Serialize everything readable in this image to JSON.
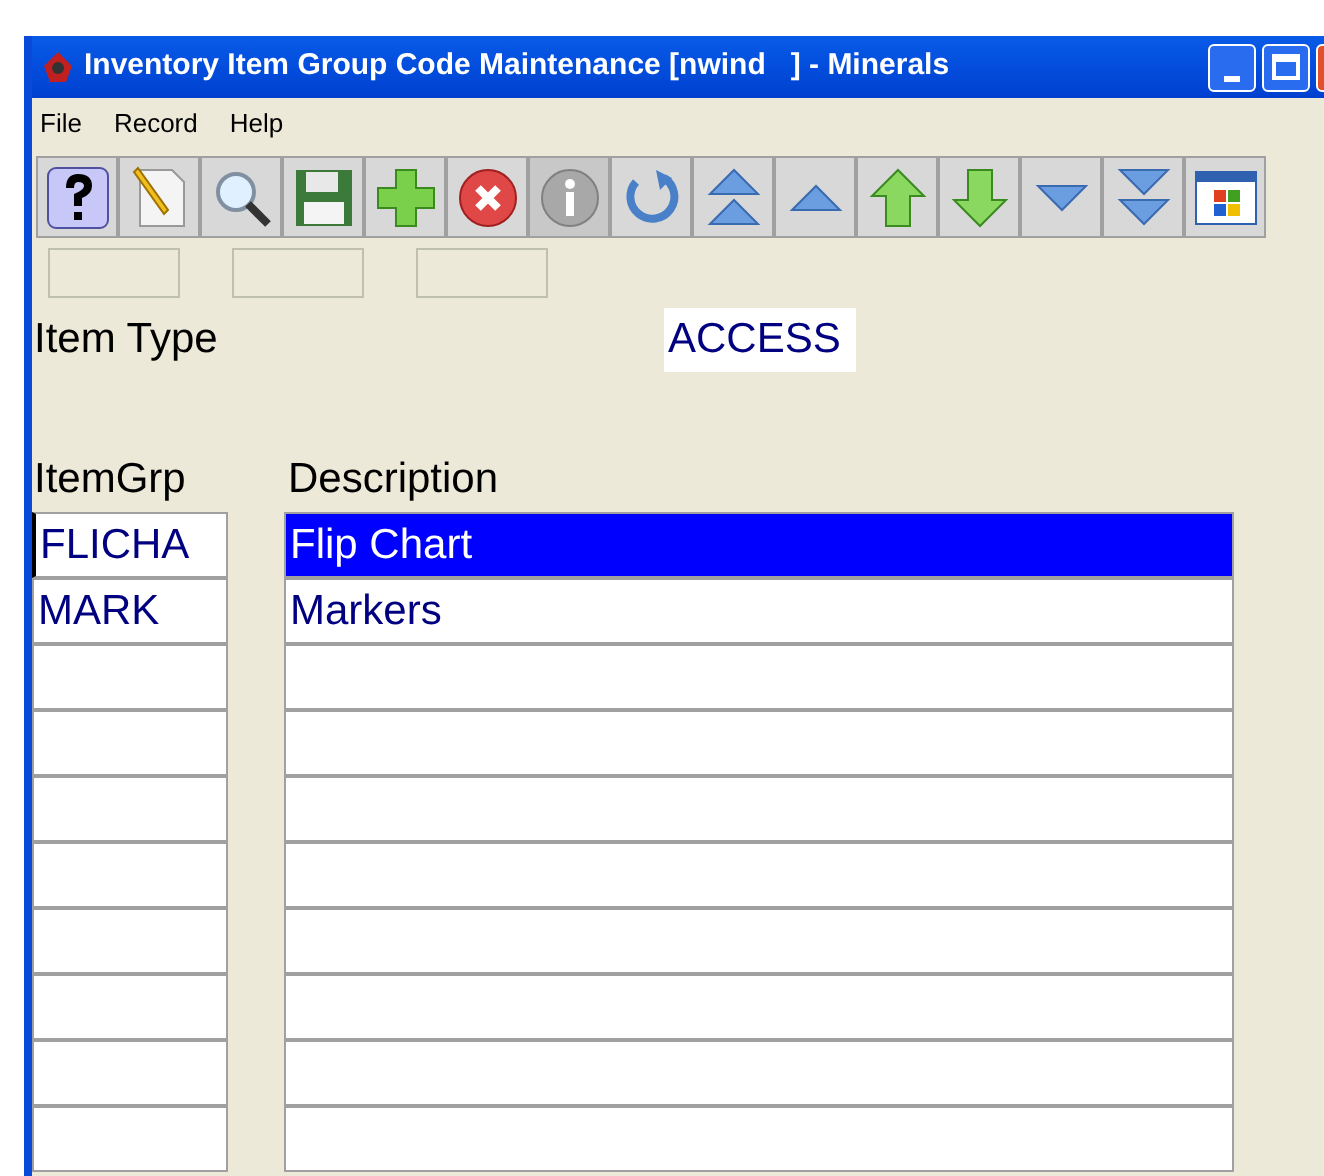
{
  "window": {
    "title": "Inventory Item Group Code Maintenance [nwind   ] - Minerals"
  },
  "menu": [
    "File",
    "Record",
    "Help"
  ],
  "toolbar": [
    {
      "kind": "help"
    },
    {
      "kind": "new"
    },
    {
      "kind": "find"
    },
    {
      "kind": "save"
    },
    {
      "kind": "add"
    },
    {
      "kind": "delete"
    },
    {
      "kind": "info",
      "disabled": true
    },
    {
      "kind": "undo"
    },
    {
      "kind": "first"
    },
    {
      "kind": "prev"
    },
    {
      "kind": "up"
    },
    {
      "kind": "down"
    },
    {
      "kind": "next"
    },
    {
      "kind": "last"
    },
    {
      "kind": "window"
    }
  ],
  "item_type": {
    "label": "Item Type",
    "value": "ACCESS"
  },
  "table": {
    "columns": [
      "ItemGrp",
      "Description"
    ],
    "rows": [
      {
        "item_grp": "FLICHA",
        "description": "Flip Chart",
        "selected": true
      },
      {
        "item_grp": "MARK",
        "description": "Markers",
        "selected": false
      }
    ]
  }
}
